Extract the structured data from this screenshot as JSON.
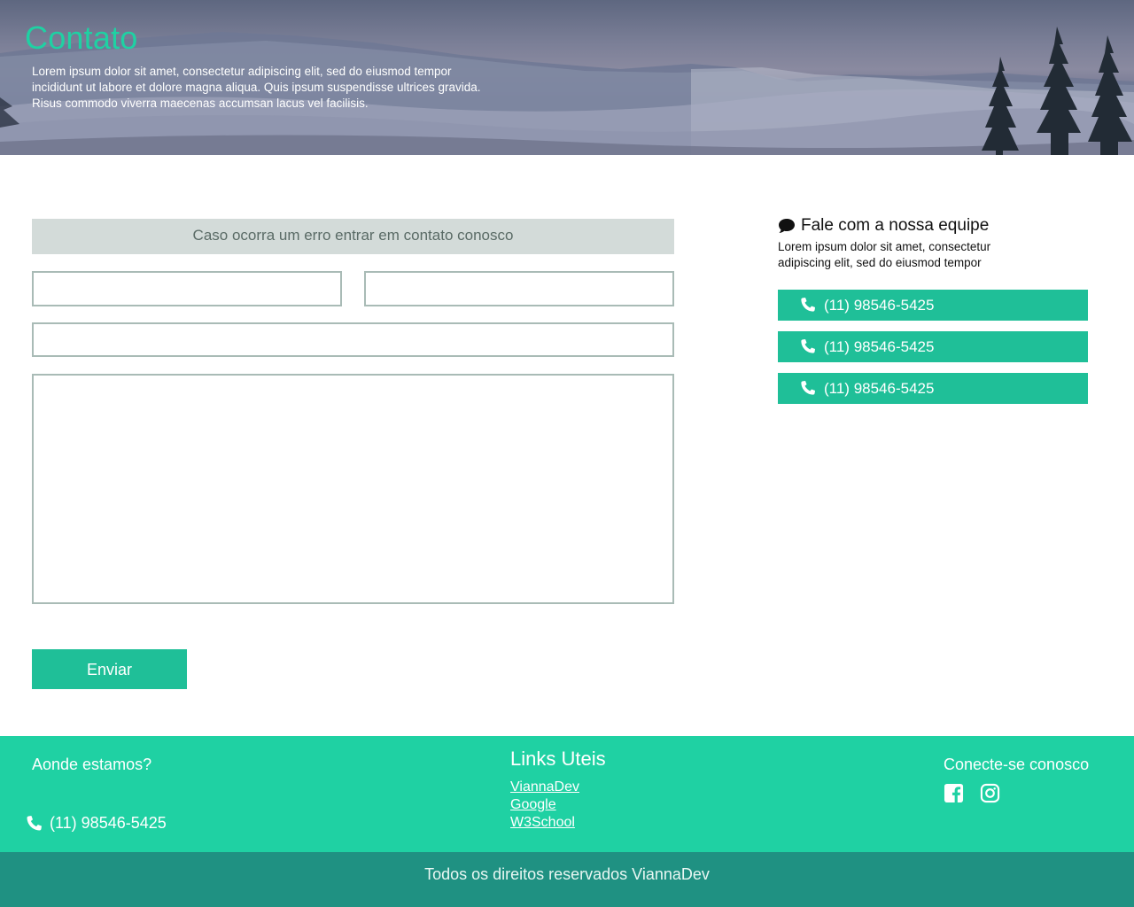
{
  "hero": {
    "title": "Contato",
    "description": "Lorem ipsum dolor sit amet, consectetur adipiscing elit, sed do eiusmod tempor incididunt ut labore et dolore magna aliqua. Quis ipsum suspendisse ultrices gravida. Risus commodo viverra maecenas accumsan lacus vel facilisis."
  },
  "form": {
    "banner": "Caso ocorra um erro entrar em contato conosco",
    "first_field": "",
    "second_field": "",
    "third_field": "",
    "message": "",
    "submit_label": "Enviar"
  },
  "side": {
    "title": "Fale com a nossa equipe",
    "description": "Lorem ipsum dolor sit amet, consectetur adipiscing elit, sed do eiusmod tempor",
    "phones": [
      "(11) 98546-5425",
      "(11) 98546-5425",
      "(11) 98546-5425"
    ]
  },
  "footer": {
    "where_title": "Aonde estamos?",
    "phone": "(11) 98546-5425",
    "links_title": "Links Uteis",
    "links": [
      "ViannaDev",
      "Google",
      "W3School"
    ],
    "connect_title": "Conecte-se conosco",
    "social_icons": [
      "facebook-icon",
      "instagram-icon"
    ]
  },
  "copyright": "Todos os direitos reservados ViannaDev",
  "colors": {
    "accent": "#1fd1a3",
    "button": "#1fbf98",
    "footer_bottom": "#1f9182",
    "banner_bg": "#d3dbd9"
  }
}
